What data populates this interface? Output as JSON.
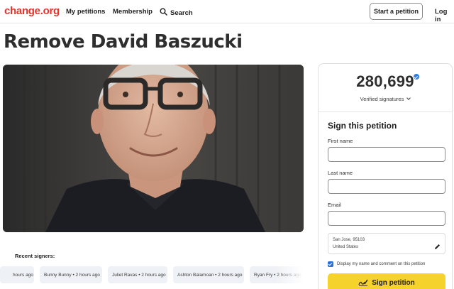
{
  "header": {
    "logo": "change.org",
    "nav": [
      "My petitions",
      "Membership"
    ],
    "search_label": "Search",
    "start_button": "Start a petition",
    "login": "Log in"
  },
  "petition": {
    "title": "Remove David Baszucki"
  },
  "recent": {
    "title": "Recent signers:",
    "signers": [
      "hours ago",
      "Bunny Bunny • 2 hours ago",
      "Juliet Ravas • 2 hours ago",
      "Ashton Balamoan • 2 hours ago",
      "Ryan Fry • 2 hours ago"
    ]
  },
  "panel": {
    "count": "280,699",
    "verified_label": "Verified signatures",
    "sign_title": "Sign this petition",
    "first_name_label": "First name",
    "last_name_label": "Last name",
    "email_label": "Email",
    "first_name_value": "",
    "last_name_value": "",
    "email_value": "",
    "location_city": "San Jose, 95103",
    "location_country": "United States",
    "display_checkbox_label": "Display my name and comment on this petition",
    "sign_button": "Sign petition"
  },
  "colors": {
    "brand_red": "#e8312a",
    "sign_button_yellow": "#f5d22c",
    "checkbox_blue": "#2c6fd6",
    "verified_blue": "#2e7de9"
  },
  "icons": [
    "search-icon",
    "verified-check-icon",
    "chevron-down-icon",
    "pencil-icon",
    "checkbox-checked-icon",
    "signature-pen-icon"
  ]
}
